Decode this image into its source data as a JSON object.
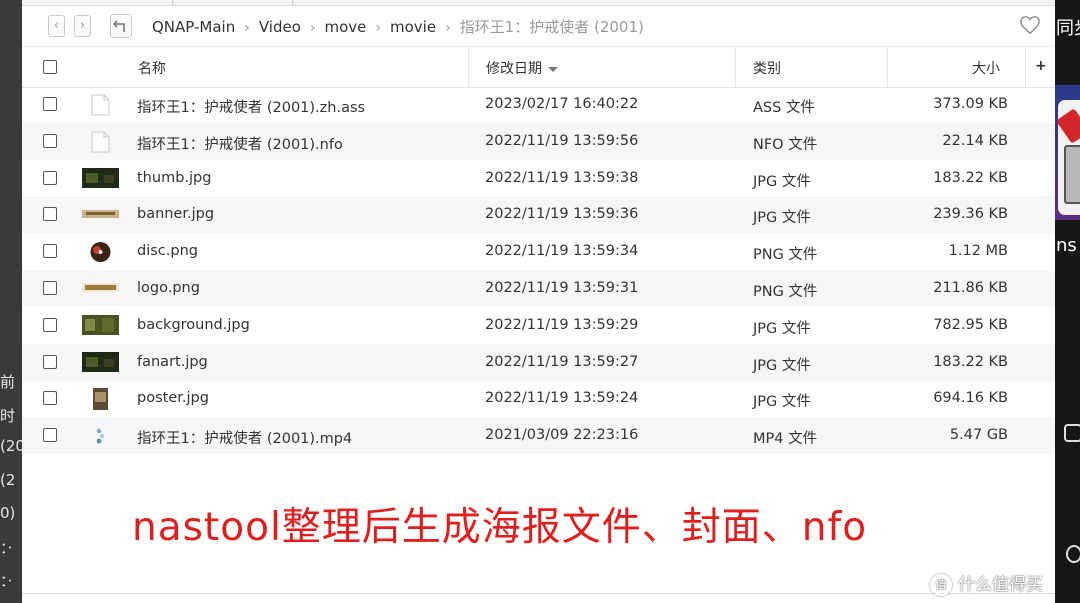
{
  "left_strip_lines": [
    "前",
    "时",
    "(20",
    "(2",
    "0)",
    "：·",
    "：·"
  ],
  "right_strip": {
    "top_text": "同步",
    "mid_text": "ns"
  },
  "breadcrumb": {
    "items": [
      "QNAP-Main",
      "Video",
      "move",
      "movie"
    ],
    "current": "指环王1：护戒使者 (2001)"
  },
  "columns": {
    "name": "名称",
    "modified": "修改日期",
    "type": "类别",
    "size": "大小",
    "add": "+"
  },
  "files": [
    {
      "name": "指环王1：护戒使者 (2001).zh.ass",
      "modified": "2023/02/17 16:40:22",
      "type": "ASS 文件",
      "size": "373.09 KB",
      "thumb": "blank"
    },
    {
      "name": "指环王1：护戒使者 (2001).nfo",
      "modified": "2022/11/19 13:59:56",
      "type": "NFO 文件",
      "size": "22.14 KB",
      "thumb": "blank"
    },
    {
      "name": "thumb.jpg",
      "modified": "2022/11/19 13:59:38",
      "type": "JPG 文件",
      "size": "183.22 KB",
      "thumb": "dark"
    },
    {
      "name": "banner.jpg",
      "modified": "2022/11/19 13:59:36",
      "type": "JPG 文件",
      "size": "239.36 KB",
      "thumb": "banner"
    },
    {
      "name": "disc.png",
      "modified": "2022/11/19 13:59:34",
      "type": "PNG 文件",
      "size": "1.12 MB",
      "thumb": "disc"
    },
    {
      "name": "logo.png",
      "modified": "2022/11/19 13:59:31",
      "type": "PNG 文件",
      "size": "211.86 KB",
      "thumb": "logo"
    },
    {
      "name": "background.jpg",
      "modified": "2022/11/19 13:59:29",
      "type": "JPG 文件",
      "size": "782.95 KB",
      "thumb": "bg"
    },
    {
      "name": "fanart.jpg",
      "modified": "2022/11/19 13:59:27",
      "type": "JPG 文件",
      "size": "183.22 KB",
      "thumb": "dark"
    },
    {
      "name": "poster.jpg",
      "modified": "2022/11/19 13:59:24",
      "type": "JPG 文件",
      "size": "694.16 KB",
      "thumb": "poster"
    },
    {
      "name": "指环王1：护戒使者 (2001).mp4",
      "modified": "2021/03/09 22:23:16",
      "type": "MP4 文件",
      "size": "5.47 GB",
      "thumb": "video"
    }
  ],
  "caption": "nastool整理后生成海报文件、封面、nfo",
  "watermark": "什么值得买",
  "watermark_logo": "值",
  "colors": {
    "caption": "#e01e1e",
    "row_alt": "#f6f6f6"
  }
}
